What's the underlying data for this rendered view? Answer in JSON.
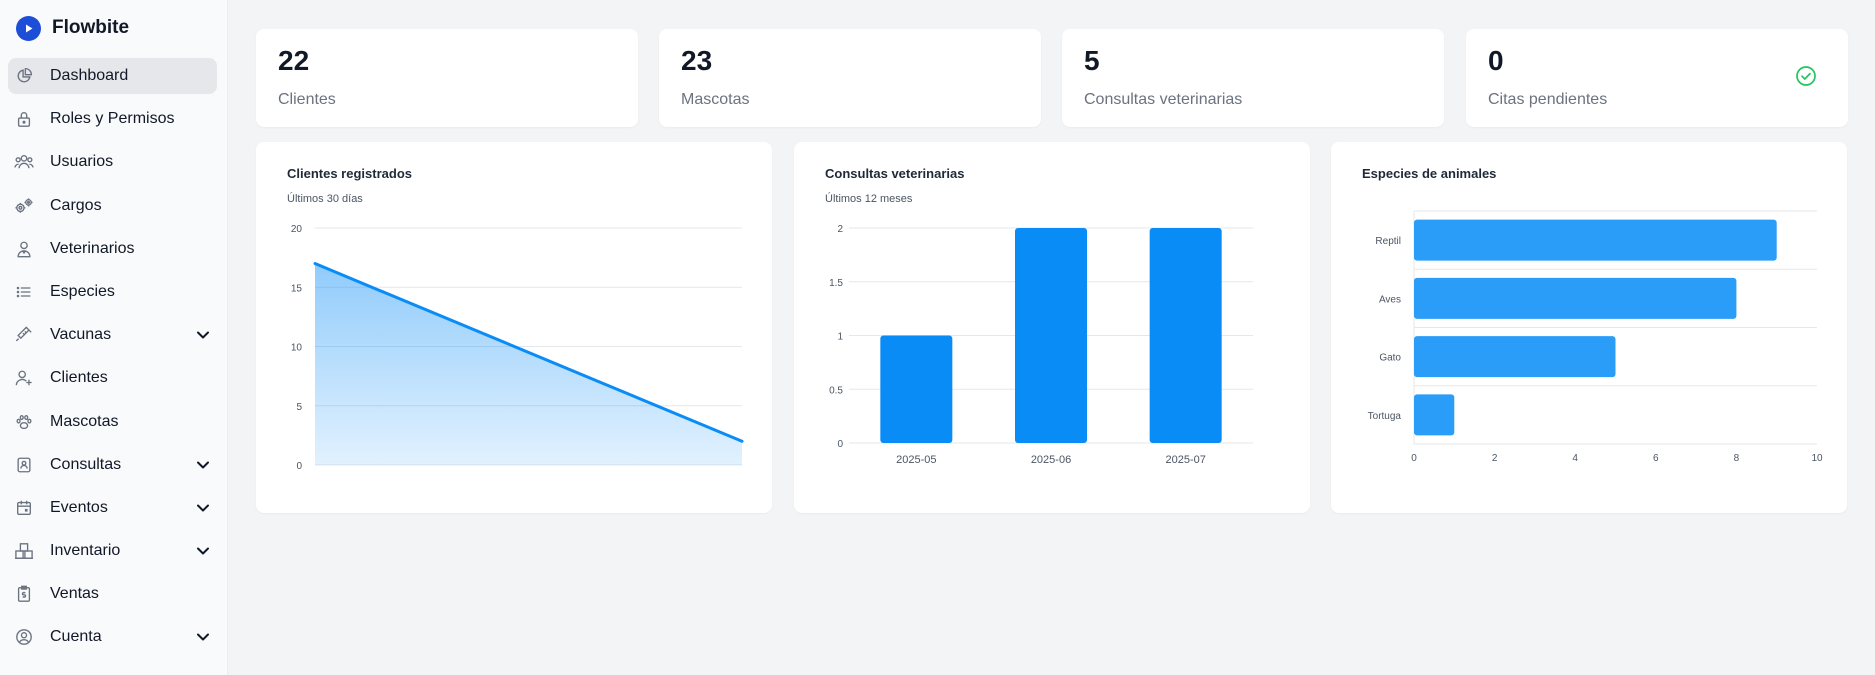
{
  "brand": {
    "name": "Flowbite",
    "icon": "play-logo-icon"
  },
  "sidebar": {
    "items": [
      {
        "label": "Dashboard",
        "icon": "chart-pie-icon",
        "active": true,
        "expandable": false
      },
      {
        "label": "Roles y Permisos",
        "icon": "lock-icon",
        "active": false,
        "expandable": false
      },
      {
        "label": "Usuarios",
        "icon": "users-icon",
        "active": false,
        "expandable": false
      },
      {
        "label": "Cargos",
        "icon": "cogs-icon",
        "active": false,
        "expandable": false
      },
      {
        "label": "Veterinarios",
        "icon": "doctor-icon",
        "active": false,
        "expandable": false
      },
      {
        "label": "Especies",
        "icon": "list-icon",
        "active": false,
        "expandable": false
      },
      {
        "label": "Vacunas",
        "icon": "syringe-icon",
        "active": false,
        "expandable": true
      },
      {
        "label": "Clientes",
        "icon": "user-add-icon",
        "active": false,
        "expandable": false
      },
      {
        "label": "Mascotas",
        "icon": "paw-icon",
        "active": false,
        "expandable": false
      },
      {
        "label": "Consultas",
        "icon": "clipboard-icon",
        "active": false,
        "expandable": true
      },
      {
        "label": "Eventos",
        "icon": "calendar-icon",
        "active": false,
        "expandable": true
      },
      {
        "label": "Inventario",
        "icon": "boxes-icon",
        "active": false,
        "expandable": true
      },
      {
        "label": "Ventas",
        "icon": "receipt-icon",
        "active": false,
        "expandable": false
      },
      {
        "label": "Cuenta",
        "icon": "user-circle-icon",
        "active": false,
        "expandable": true
      }
    ]
  },
  "stats": [
    {
      "value": "22",
      "label": "Clientes"
    },
    {
      "value": "23",
      "label": "Mascotas"
    },
    {
      "value": "5",
      "label": "Consultas veterinarias"
    },
    {
      "value": "0",
      "label": "Citas pendientes",
      "icon": "check-circle-icon",
      "icon_color": "#22c55e"
    }
  ],
  "charts": {
    "clientes": {
      "title": "Clientes registrados",
      "subtitle": "Últimos 30 días"
    },
    "consultas": {
      "title": "Consultas veterinarias",
      "subtitle": "Últimos 12 meses"
    },
    "especies": {
      "title": "Especies de animales"
    }
  },
  "colors": {
    "accent": "#0a8cf7",
    "bar": "#0a8cf7",
    "hbar": "#2a9df9",
    "active_bg": "#e5e7eb"
  },
  "chart_data": [
    {
      "type": "area",
      "title": "Clientes registrados",
      "subtitle": "Últimos 30 días",
      "x": [
        0,
        1
      ],
      "values": [
        17,
        2
      ],
      "ylim": [
        0,
        20
      ],
      "yticks": [
        "0",
        "5",
        "10",
        "15",
        "20"
      ],
      "grid": true
    },
    {
      "type": "bar",
      "title": "Consultas veterinarias",
      "subtitle": "Últimos 12 meses",
      "categories": [
        "2025-05",
        "2025-06",
        "2025-07"
      ],
      "values": [
        1,
        2,
        2
      ],
      "ylim": [
        0,
        2
      ],
      "yticks": [
        "0",
        "0.5",
        "1",
        "1.5",
        "2"
      ],
      "grid": true
    },
    {
      "type": "bar",
      "orientation": "horizontal",
      "title": "Especies de animales",
      "categories": [
        "Reptil",
        "Aves",
        "Gato",
        "Tortuga"
      ],
      "values": [
        9,
        8,
        5,
        1
      ],
      "xlim": [
        0,
        10
      ],
      "xticks": [
        "0",
        "2",
        "4",
        "6",
        "8",
        "10"
      ],
      "grid": true
    }
  ]
}
